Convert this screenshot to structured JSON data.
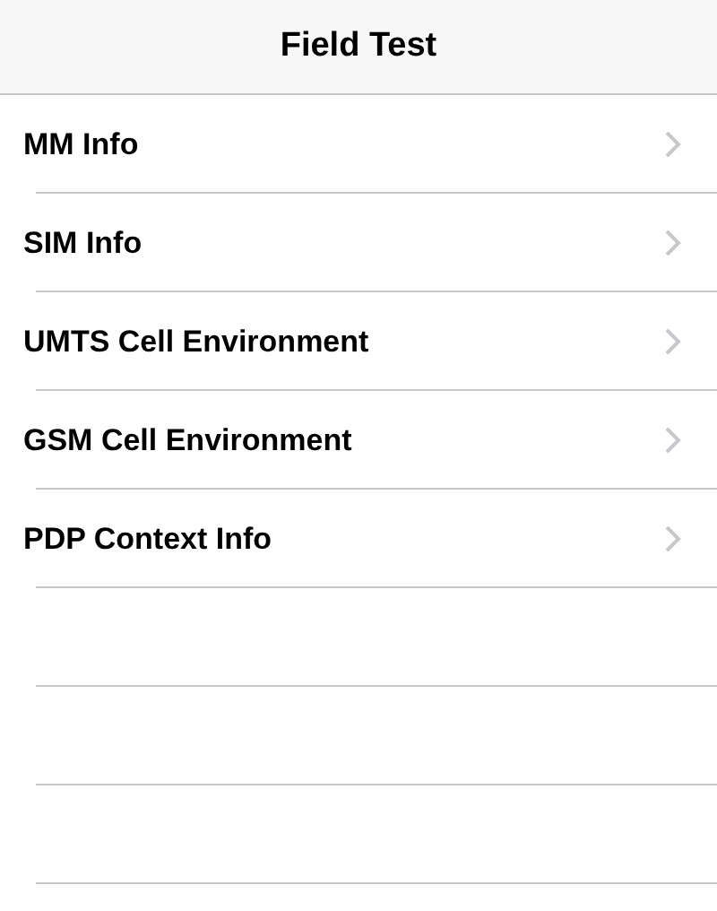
{
  "navigation_bar": {
    "title": "Field Test"
  },
  "items": [
    {
      "label": "MM Info"
    },
    {
      "label": "SIM Info"
    },
    {
      "label": "UMTS Cell Environment"
    },
    {
      "label": "GSM Cell Environment"
    },
    {
      "label": "PDP Context Info"
    }
  ]
}
